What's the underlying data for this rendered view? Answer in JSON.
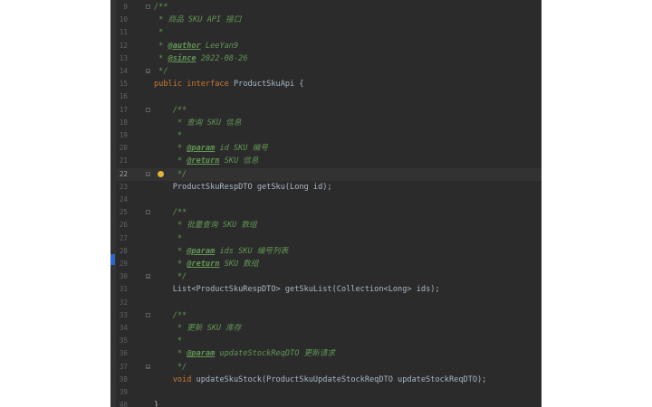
{
  "lines": [
    {
      "n": "9",
      "segs": [
        [
          "doc",
          "/**"
        ]
      ]
    },
    {
      "n": "10",
      "segs": [
        [
          "doc",
          " * 商品 SKU API 接口"
        ]
      ]
    },
    {
      "n": "11",
      "segs": [
        [
          "doc",
          " *"
        ]
      ]
    },
    {
      "n": "12",
      "segs": [
        [
          "doc",
          " * "
        ],
        [
          "tag",
          "@author"
        ],
        [
          "doc",
          " LeeYan9"
        ]
      ]
    },
    {
      "n": "13",
      "segs": [
        [
          "doc",
          " * "
        ],
        [
          "tag",
          "@since"
        ],
        [
          "doc",
          " 2022-08-26"
        ]
      ]
    },
    {
      "n": "14",
      "segs": [
        [
          "doc",
          " */"
        ]
      ]
    },
    {
      "n": "15",
      "segs": [
        [
          "kw",
          "public interface "
        ],
        [
          "plain",
          "ProductSkuApi {"
        ]
      ]
    },
    {
      "n": "16",
      "segs": []
    },
    {
      "n": "17",
      "segs": [
        [
          "doc",
          "    /**"
        ]
      ]
    },
    {
      "n": "18",
      "segs": [
        [
          "doc",
          "     * 查询 SKU 信息"
        ]
      ]
    },
    {
      "n": "19",
      "segs": [
        [
          "doc",
          "     *"
        ]
      ]
    },
    {
      "n": "20",
      "segs": [
        [
          "doc",
          "     * "
        ],
        [
          "tag",
          "@param"
        ],
        [
          "doc",
          " id SKU 编号"
        ]
      ]
    },
    {
      "n": "21",
      "segs": [
        [
          "doc",
          "     * "
        ],
        [
          "tag",
          "@return"
        ],
        [
          "doc",
          " SKU 信息"
        ]
      ]
    },
    {
      "n": "22",
      "segs": [
        [
          "doc",
          "     */"
        ]
      ]
    },
    {
      "n": "23",
      "segs": [
        [
          "plain",
          "    ProductSkuRespDTO getSku(Long id);"
        ]
      ]
    },
    {
      "n": "24",
      "segs": []
    },
    {
      "n": "25",
      "segs": [
        [
          "doc",
          "    /**"
        ]
      ]
    },
    {
      "n": "26",
      "segs": [
        [
          "doc",
          "     * 批量查询 SKU 数组"
        ]
      ]
    },
    {
      "n": "27",
      "segs": [
        [
          "doc",
          "     *"
        ]
      ]
    },
    {
      "n": "28",
      "segs": [
        [
          "doc",
          "     * "
        ],
        [
          "tag",
          "@param"
        ],
        [
          "doc",
          " ids SKU 编号列表"
        ]
      ]
    },
    {
      "n": "29",
      "segs": [
        [
          "doc",
          "     * "
        ],
        [
          "tag",
          "@return"
        ],
        [
          "doc",
          " SKU 数组"
        ]
      ]
    },
    {
      "n": "30",
      "segs": [
        [
          "doc",
          "     */"
        ]
      ]
    },
    {
      "n": "31",
      "segs": [
        [
          "plain",
          "    List<ProductSkuRespDTO> getSkuList(Collection<Long> ids);"
        ]
      ]
    },
    {
      "n": "32",
      "segs": []
    },
    {
      "n": "33",
      "segs": [
        [
          "doc",
          "    /**"
        ]
      ]
    },
    {
      "n": "34",
      "segs": [
        [
          "doc",
          "     * 更新 SKU 库存"
        ]
      ]
    },
    {
      "n": "35",
      "segs": [
        [
          "doc",
          "     *"
        ]
      ]
    },
    {
      "n": "36",
      "segs": [
        [
          "doc",
          "     * "
        ],
        [
          "tag",
          "@param"
        ],
        [
          "doc",
          " updateStockReqDTO 更新请求"
        ]
      ]
    },
    {
      "n": "37",
      "segs": [
        [
          "doc",
          "     */"
        ]
      ]
    },
    {
      "n": "38",
      "segs": [
        [
          "kw",
          "    void "
        ],
        [
          "plain",
          "updateSkuStock(ProductSkuUpdateStockReqDTO updateStockReqDTO);"
        ]
      ]
    },
    {
      "n": "39",
      "segs": []
    },
    {
      "n": "40",
      "segs": [
        [
          "plain",
          "}"
        ]
      ]
    }
  ],
  "current_line": "22",
  "fold_marks": {
    "9": "start",
    "14": "end",
    "17": "start",
    "22": "end",
    "25": "start",
    "30": "end",
    "33": "start",
    "37": "end"
  },
  "intention_bulb_line": "22",
  "colors": {
    "background": "#2b2b2b",
    "doc_comment": "#629755",
    "keyword": "#cc7832",
    "identifier": "#a9b7c6",
    "line_number": "#606366"
  },
  "icons": {
    "intention": "lightbulb-icon",
    "fold": "fold-toggle-icon"
  }
}
